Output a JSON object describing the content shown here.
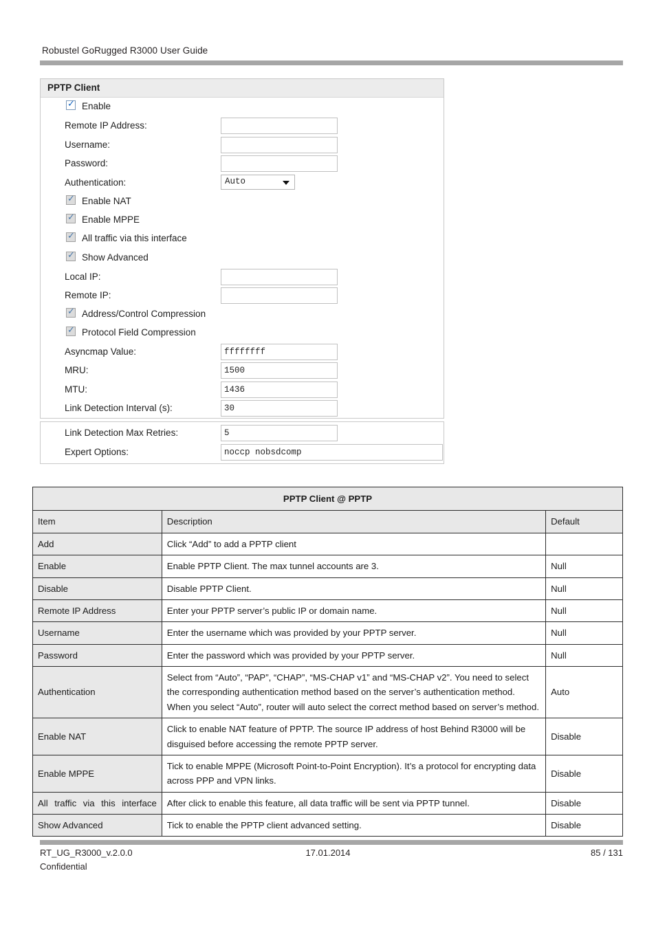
{
  "document": {
    "running_header": "Robustel GoRugged R3000 User Guide",
    "footer": {
      "doc_id": "RT_UG_R3000_v.2.0.0",
      "confidential": "Confidential",
      "date": "17.01.2014",
      "page": "85 / 131"
    }
  },
  "screenshot": {
    "panel_title": "PPTP Client",
    "fields": {
      "enable": {
        "label": "Enable",
        "checked": true,
        "style": "active"
      },
      "remote_ip_address": {
        "label": "Remote IP Address:",
        "value": ""
      },
      "username": {
        "label": "Username:",
        "value": ""
      },
      "password": {
        "label": "Password:",
        "value": ""
      },
      "authentication": {
        "label": "Authentication:",
        "value": "Auto"
      },
      "enable_nat": {
        "label": "Enable NAT",
        "checked": true,
        "style": "muted"
      },
      "enable_mppe": {
        "label": "Enable MPPE",
        "checked": true,
        "style": "muted"
      },
      "all_traffic": {
        "label": "All traffic via this interface",
        "checked": true,
        "style": "muted"
      },
      "show_advanced": {
        "label": "Show Advanced",
        "checked": true,
        "style": "muted"
      },
      "local_ip": {
        "label": "Local IP:",
        "value": ""
      },
      "remote_ip": {
        "label": "Remote IP:",
        "value": ""
      },
      "addr_ctrl_compression": {
        "label": "Address/Control Compression",
        "checked": true,
        "style": "muted"
      },
      "protocol_field_compression": {
        "label": "Protocol Field Compression",
        "checked": true,
        "style": "muted"
      },
      "asyncmap_value": {
        "label": "Asyncmap Value:",
        "value": "ffffffff"
      },
      "mru": {
        "label": "MRU:",
        "value": "1500"
      },
      "mtu": {
        "label": "MTU:",
        "value": "1436"
      },
      "link_detection_interval": {
        "label": "Link Detection Interval (s):",
        "value": "30"
      },
      "link_detection_max_retries": {
        "label": "Link Detection Max Retries:",
        "value": "5"
      },
      "expert_options": {
        "label": "Expert Options:",
        "value": "noccp nobsdcomp"
      }
    },
    "icons": {
      "checkmark": "✓",
      "dropdown_caret": "▼"
    }
  },
  "spec_table": {
    "caption": "PPTP Client @ PPTP",
    "columns": [
      "Item",
      "Description",
      "Default"
    ],
    "rows": [
      {
        "item": "Add",
        "description": "Click “Add” to add a PPTP client",
        "default": ""
      },
      {
        "item": "Enable",
        "description": "Enable PPTP Client. The max tunnel accounts are 3.",
        "default": "Null"
      },
      {
        "item": "Disable",
        "description": "Disable PPTP Client.",
        "default": "Null"
      },
      {
        "item": "Remote IP Address",
        "description": "Enter your PPTP server’s public IP or domain name.",
        "default": "Null"
      },
      {
        "item": "Username",
        "description": "Enter the username which was provided by your PPTP server.",
        "default": "Null"
      },
      {
        "item": "Password",
        "description": "Enter the password which was provided by your PPTP server.",
        "default": "Null"
      },
      {
        "item": "Authentication",
        "description": "Select from “Auto”, “PAP”, “CHAP”, “MS-CHAP v1” and “MS-CHAP v2”. You need to select the corresponding authentication method based on the server’s authentication method. When you select “Auto”, router will auto select the correct method based on server’s method.",
        "default": "Auto"
      },
      {
        "item": "Enable NAT",
        "description": "Click to enable NAT feature of PPTP. The source IP address of host Behind R3000 will be disguised before accessing the remote PPTP server.",
        "default": "Disable"
      },
      {
        "item": "Enable MPPE",
        "description": "Tick to enable MPPE (Microsoft Point-to-Point Encryption). It’s a protocol for encrypting data across PPP and VPN links.",
        "default": "Disable"
      },
      {
        "item": "All traffic via this interface",
        "description": "After click to enable this feature, all data traffic will be sent via PPTP tunnel.",
        "default": "Disable"
      },
      {
        "item": "Show Advanced",
        "description": "Tick to enable the PPTP client advanced setting.",
        "default": "Disable"
      }
    ]
  }
}
